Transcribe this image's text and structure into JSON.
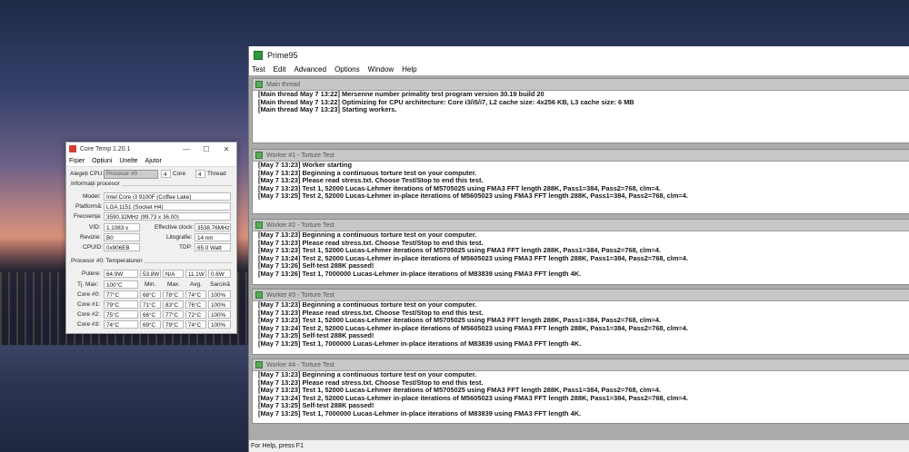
{
  "coretemp": {
    "title": "Core Temp 1.20.1",
    "win_min": "—",
    "win_max": "☐",
    "win_close": "✕",
    "menu": [
      "Fișier",
      "Opțiuni",
      "Unelte",
      "Ajutor"
    ],
    "cpu_select_label": "Alegeți CPU:",
    "cpu_select_value": "Procesor #0",
    "core_count": "4",
    "core_label": "Core",
    "thread_count": "4",
    "thread_label": "Thread",
    "info_title": "Informații procesor",
    "model_label": "Model:",
    "model_value": "Intel Core i3 9100F (Coffee Lake)",
    "platform_label": "Platformă:",
    "platform_value": "LGA 1151 (Socket H4)",
    "freq_label": "Frecvența:",
    "freq_value": "3590.32MHz (99.73 x 36.00)",
    "vid_label": "VID:",
    "vid_value": "1.1083 v",
    "eff_clock_label": "Effective clock:",
    "eff_clock_value": "3538.76MHz",
    "revision_label": "Revizie:",
    "revision_value": "B0",
    "litho_label": "Litografie:",
    "litho_value": "14 nm",
    "cpuid_label": "CPUID:",
    "cpuid_value": "0x906EB",
    "tdp_label": "TDP:",
    "tdp_value": "65.0 Watt",
    "temps_title": "Procesor #0: Temperaturen",
    "power_label": "Putere:",
    "power_values": [
      "64.9W",
      "53.8W",
      "N/A",
      "11.1W",
      "0.6W"
    ],
    "tjmax_label": "Tj. Max:",
    "tjmax_value": "100°C",
    "col_headers": [
      "Min.",
      "Max.",
      "Avg.",
      "Sarcină"
    ],
    "cores": [
      {
        "label": "Core #0:",
        "temp": "77°C",
        "min": "68°C",
        "max": "78°C",
        "avg": "74°C",
        "load": "100%"
      },
      {
        "label": "Core #1:",
        "temp": "79°C",
        "min": "71°C",
        "max": "83°C",
        "avg": "76°C",
        "load": "100%"
      },
      {
        "label": "Core #2:",
        "temp": "75°C",
        "min": "66°C",
        "max": "77°C",
        "avg": "72°C",
        "load": "100%"
      },
      {
        "label": "Core #3:",
        "temp": "74°C",
        "min": "69°C",
        "max": "79°C",
        "avg": "74°C",
        "load": "100%"
      }
    ]
  },
  "prime95": {
    "title": "Prime95",
    "menu": [
      "Test",
      "Edit",
      "Advanced",
      "Options",
      "Window",
      "Help"
    ],
    "status": "For Help, press F1",
    "panes": [
      {
        "title": "Main thread",
        "lines": [
          "[Main thread May  7 13:22] Mersenne number primality test program version 30.19 build 20",
          "[Main thread May  7 13:22] Optimizing for CPU architecture: Core i3/i5/i7, L2 cache size: 4x256 KB, L3 cache size: 6 MB",
          "[Main thread May  7 13:23] Starting workers."
        ]
      },
      {
        "title": "Worker #1 - Torture Test",
        "lines": [
          "[May  7 13:23] Worker starting",
          "[May  7 13:23] Beginning a continuous torture test on your computer.",
          "[May  7 13:23] Please read stress.txt.  Choose Test/Stop to end this test.",
          "[May  7 13:23] Test 1, 52000 Lucas-Lehmer iterations of M5705025 using FMA3 FFT length 288K, Pass1=384, Pass2=768, clm=4.",
          "[May  7 13:25] Test 2, 52000 Lucas-Lehmer in-place iterations of M5605023 using FMA3 FFT length 288K, Pass1=384, Pass2=768, clm=4."
        ]
      },
      {
        "title": "Worker #2 - Torture Test",
        "lines": [
          "[May  7 13:23] Beginning a continuous torture test on your computer.",
          "[May  7 13:23] Please read stress.txt.  Choose Test/Stop to end this test.",
          "[May  7 13:23] Test 1, 52000 Lucas-Lehmer iterations of M5705025 using FMA3 FFT length 288K, Pass1=384, Pass2=768, clm=4.",
          "[May  7 13:24] Test 2, 52000 Lucas-Lehmer in-place iterations of M5605023 using FMA3 FFT length 288K, Pass1=384, Pass2=768, clm=4.",
          "[May  7 13:26] Self-test 288K passed!",
          "[May  7 13:26] Test 1, 7000000 Lucas-Lehmer in-place iterations of M83839 using FMA3 FFT length 4K."
        ]
      },
      {
        "title": "Worker #3 - Torture Test",
        "lines": [
          "[May  7 13:23] Beginning a continuous torture test on your computer.",
          "[May  7 13:23] Please read stress.txt.  Choose Test/Stop to end this test.",
          "[May  7 13:23] Test 1, 52000 Lucas-Lehmer iterations of M5705025 using FMA3 FFT length 288K, Pass1=384, Pass2=768, clm=4.",
          "[May  7 13:24] Test 2, 52000 Lucas-Lehmer in-place iterations of M5605023 using FMA3 FFT length 288K, Pass1=384, Pass2=768, clm=4.",
          "[May  7 13:25] Self-test 288K passed!",
          "[May  7 13:25] Test 1, 7000000 Lucas-Lehmer in-place iterations of M83839 using FMA3 FFT length 4K."
        ]
      },
      {
        "title": "Worker #4 - Torture Test",
        "lines": [
          "[May  7 13:23] Beginning a continuous torture test on your computer.",
          "[May  7 13:23] Please read stress.txt.  Choose Test/Stop to end this test.",
          "[May  7 13:23] Test 1, 52000 Lucas-Lehmer iterations of M5705025 using FMA3 FFT length 288K, Pass1=384, Pass2=768, clm=4.",
          "[May  7 13:24] Test 2, 52000 Lucas-Lehmer in-place iterations of M5605023 using FMA3 FFT length 288K, Pass1=384, Pass2=768, clm=4.",
          "[May  7 13:25] Self-test 288K passed!",
          "[May  7 13:25] Test 1, 7000000 Lucas-Lehmer in-place iterations of M83839 using FMA3 FFT length 4K."
        ]
      }
    ]
  }
}
